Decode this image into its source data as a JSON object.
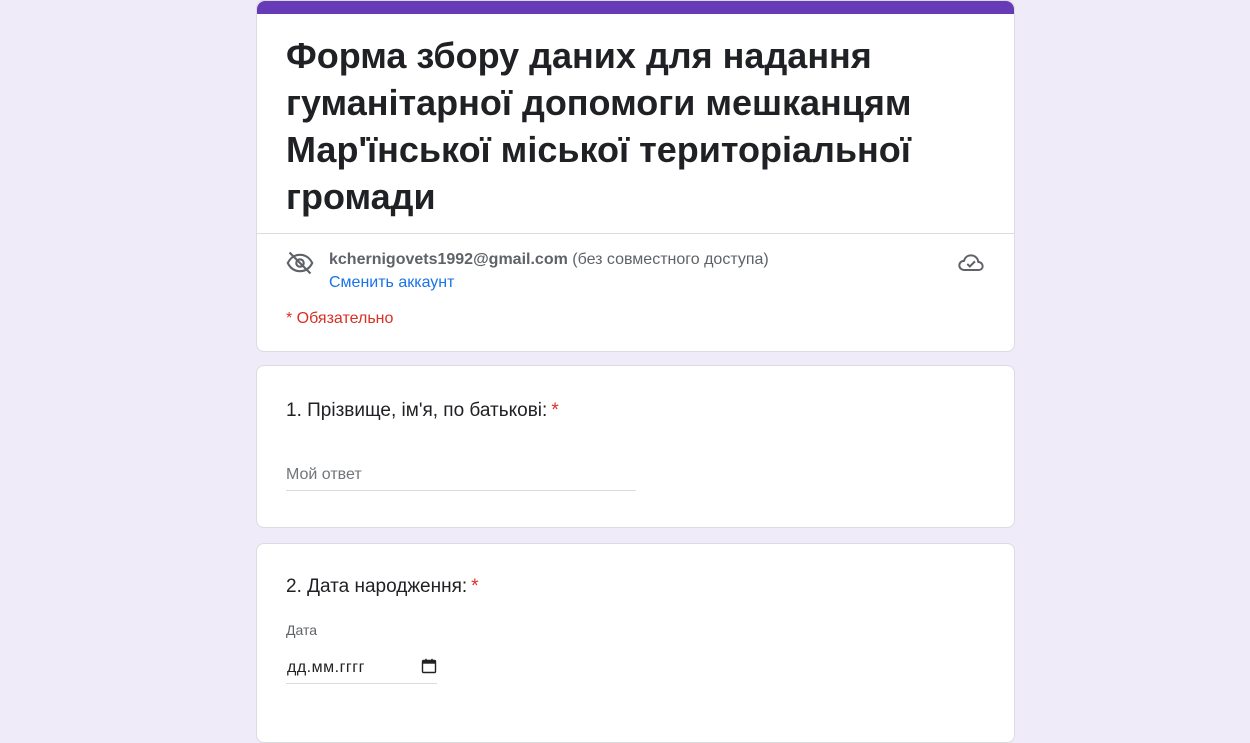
{
  "form": {
    "title": "Форма збору даних для надання гуманітарної допомоги мешканцям Мар'їнської міської територіальної громади",
    "accent_color": "#673ab7",
    "background_color": "#efebf8"
  },
  "account": {
    "email": "kchernigovets1992@gmail.com",
    "sharing_status": "(без совместного доступа)",
    "switch_label": "Сменить аккаунт",
    "privacy_icon": "eye-off-icon",
    "save_icon": "cloud-done-icon"
  },
  "required_note": "* Обязательно",
  "questions": [
    {
      "title": "1. Прізвище, ім'я, по батькові:",
      "required_mark": "*",
      "placeholder": "Мой ответ"
    },
    {
      "title": "2. Дата народження:",
      "required_mark": "*",
      "field_label": "Дата",
      "date_placeholder": "дд.мм.гггг",
      "calendar_icon": "calendar-icon"
    }
  ]
}
